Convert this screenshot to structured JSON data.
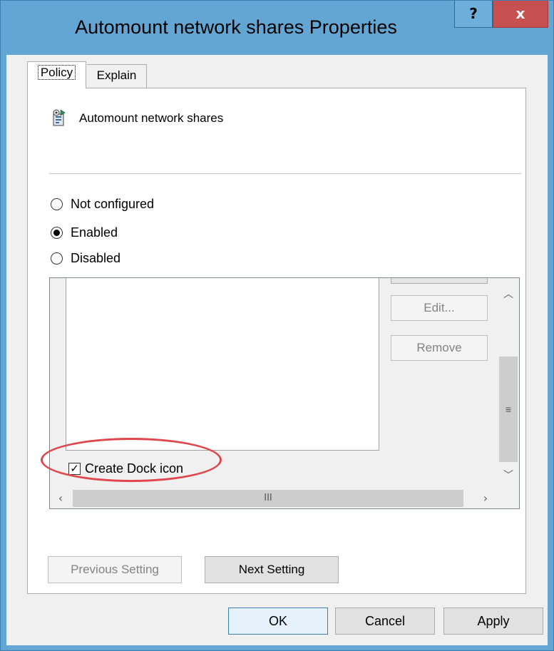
{
  "window": {
    "title": "Automount network shares Properties",
    "help_label": "?",
    "close_label": "x"
  },
  "tabs": [
    {
      "label": "Policy",
      "selected": true
    },
    {
      "label": "Explain",
      "selected": false
    }
  ],
  "policy": {
    "name": "Automount network shares"
  },
  "radios": [
    {
      "label": "Not configured",
      "checked": false
    },
    {
      "label": "Enabled",
      "checked": true
    },
    {
      "label": "Disabled",
      "checked": false
    }
  ],
  "options": {
    "edit_label": "Edit...",
    "remove_label": "Remove",
    "checkbox_label": "Create Dock icon",
    "checkbox_checked": true
  },
  "nav": {
    "prev_label": "Previous Setting",
    "next_label": "Next Setting"
  },
  "buttons": {
    "ok_label": "OK",
    "cancel_label": "Cancel",
    "apply_label": "Apply"
  },
  "colors": {
    "title_bar": "#63a6d4",
    "close_button": "#c75050",
    "highlight_ring": "#e0474c"
  }
}
